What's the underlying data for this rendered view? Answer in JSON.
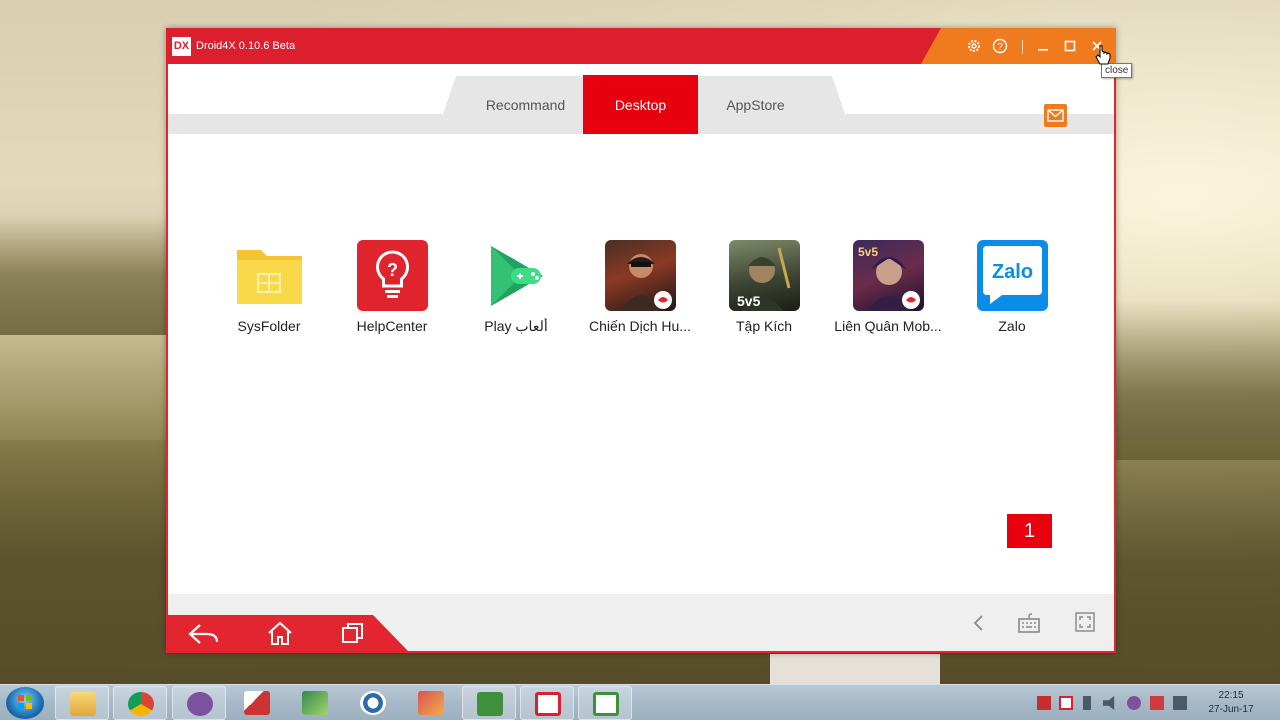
{
  "window": {
    "title": "Droid4X 0.10.6 Beta",
    "logo": "DX",
    "accent": "#dc1f2c",
    "orange": "#f07b1f"
  },
  "titlebar_buttons": {
    "settings": "settings-icon",
    "help": "help-icon",
    "minimize": "minimize-icon",
    "maximize": "maximize-icon",
    "close": "close-icon"
  },
  "tooltip": {
    "text": "close"
  },
  "tabs": [
    {
      "label": "Recommand",
      "active": false
    },
    {
      "label": "Desktop",
      "active": true
    },
    {
      "label": "AppStore",
      "active": false
    }
  ],
  "apps": [
    {
      "label": "SysFolder",
      "icon": "folder-icon"
    },
    {
      "label": "HelpCenter",
      "icon": "lightbulb-question-icon"
    },
    {
      "label": "Play ألعاب",
      "icon": "play-games-icon"
    },
    {
      "label": "Chiến Dịch Hu...",
      "icon": "game-icon"
    },
    {
      "label": "Tập Kích",
      "icon": "game-icon"
    },
    {
      "label": "Liên Quân Mob...",
      "icon": "game-icon"
    },
    {
      "label": "Zalo",
      "icon": "zalo-icon",
      "icon_text": "Zalo"
    }
  ],
  "page_indicator": "1",
  "bottom_nav": {
    "back": "back-arrow-icon",
    "home": "home-icon",
    "recent": "recent-apps-icon",
    "prev": "chevron-left-icon",
    "keyboard": "keyboard-icon",
    "fullscreen": "fullscreen-icon"
  },
  "taskbar": {
    "clock_time": "22:15",
    "clock_date": "27-Jun-17"
  }
}
